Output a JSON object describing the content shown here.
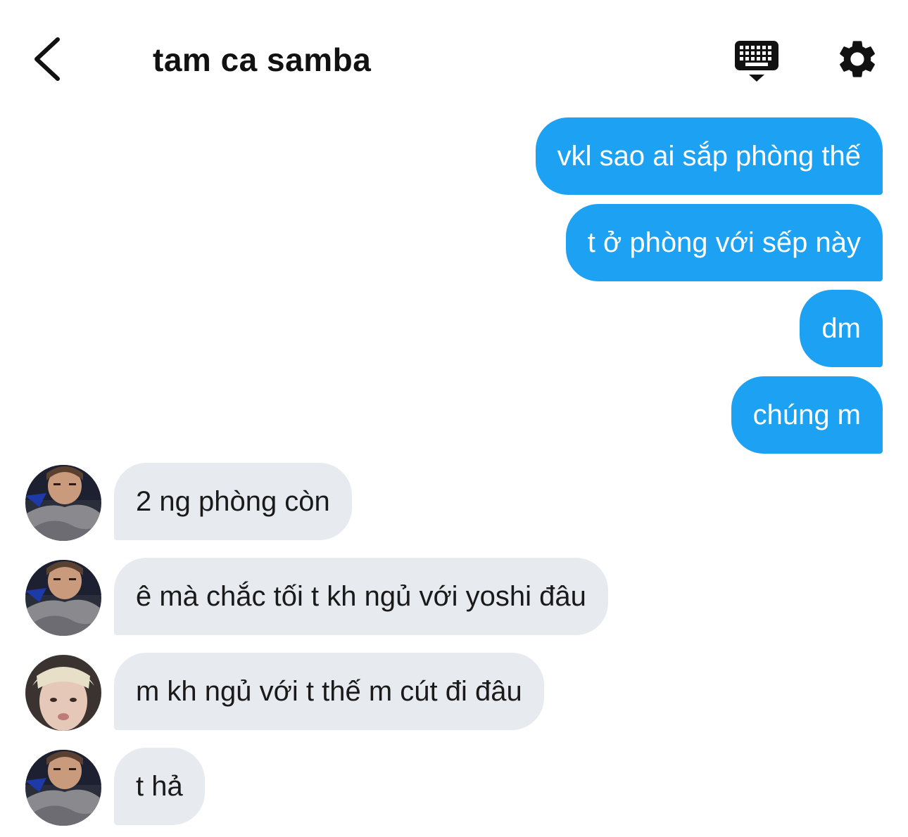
{
  "header": {
    "title": "tam ca samba"
  },
  "icons": {
    "back": "chevron-left-icon",
    "keyboard": "keyboard-icon",
    "settings": "gear-icon"
  },
  "colors": {
    "outgoing_bubble": "#1da1f2",
    "incoming_bubble": "#e7ebef"
  },
  "messages": [
    {
      "direction": "outgoing",
      "text": "vkl sao ai sắp phòng thế"
    },
    {
      "direction": "outgoing",
      "text": "t ở phòng với sếp này"
    },
    {
      "direction": "outgoing",
      "text": "dm"
    },
    {
      "direction": "outgoing",
      "text": "chúng m"
    },
    {
      "direction": "incoming",
      "text": "2 ng phòng còn"
    },
    {
      "direction": "incoming",
      "text": "ê mà chắc tối t kh ngủ với yoshi đâu"
    },
    {
      "direction": "incoming",
      "text": "m kh ngủ với t thế m cút đi đâu"
    },
    {
      "direction": "incoming",
      "text": "t hả"
    }
  ]
}
